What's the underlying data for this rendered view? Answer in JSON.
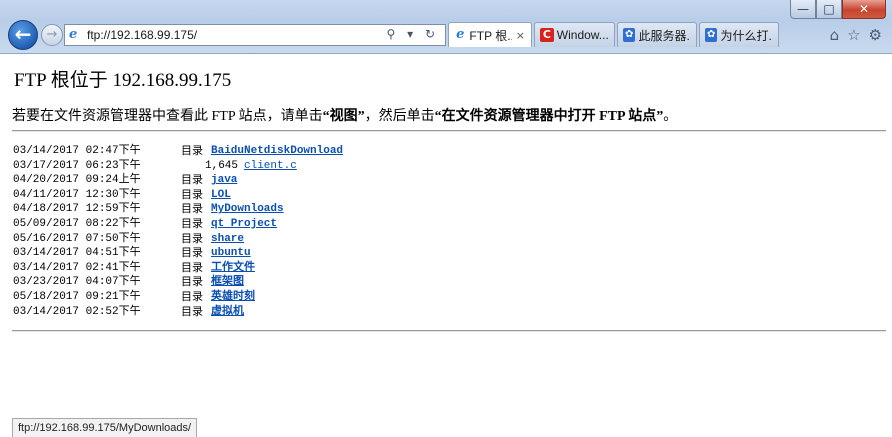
{
  "browser": {
    "address": "ftp://192.168.99.175/",
    "tabs": [
      {
        "label": "FTP 根...",
        "icon": "ie-page-icon",
        "active": true
      },
      {
        "label": "Window...",
        "icon": "red-c-icon",
        "active": false
      },
      {
        "label": "此服务器...",
        "icon": "baidu-paw-icon",
        "active": false
      },
      {
        "label": "为什么打...",
        "icon": "baidu-paw-icon",
        "active": false
      }
    ],
    "tab_close_glyph": "×",
    "addr_tool_glyphs": "⚲ ▾ ↻"
  },
  "page": {
    "heading": "FTP 根位于 192.168.99.175",
    "instruction": {
      "prefix": "若要在文件资源管理器中查看此 FTP 站点，请单击",
      "view": "“视图”",
      "middle": "，然后单击",
      "open": "“在文件资源管理器中打开 FTP 站点”",
      "suffix": "。"
    },
    "entries": [
      {
        "date": "03/14/2017 02:47下午",
        "kind": "目录",
        "size": "",
        "name": "BaiduNetdiskDownload"
      },
      {
        "date": "03/17/2017 06:23下午",
        "kind": "",
        "size": "1,645",
        "name": "client.c"
      },
      {
        "date": "04/20/2017 09:24上午",
        "kind": "目录",
        "size": "",
        "name": "java"
      },
      {
        "date": "04/11/2017 12:30下午",
        "kind": "目录",
        "size": "",
        "name": "LOL"
      },
      {
        "date": "04/18/2017 12:59下午",
        "kind": "目录",
        "size": "",
        "name": "MyDownloads"
      },
      {
        "date": "05/09/2017 08:22下午",
        "kind": "目录",
        "size": "",
        "name": "qt Project"
      },
      {
        "date": "05/16/2017 07:50下午",
        "kind": "目录",
        "size": "",
        "name": "share"
      },
      {
        "date": "03/14/2017 04:51下午",
        "kind": "目录",
        "size": "",
        "name": "ubuntu"
      },
      {
        "date": "03/14/2017 02:41下午",
        "kind": "目录",
        "size": "",
        "name": "工作文件"
      },
      {
        "date": "03/23/2017 04:07下午",
        "kind": "目录",
        "size": "",
        "name": "框架图"
      },
      {
        "date": "05/18/2017 09:21下午",
        "kind": "目录",
        "size": "",
        "name": "英雄时刻"
      },
      {
        "date": "03/14/2017 02:52下午",
        "kind": "目录",
        "size": "",
        "name": "虚拟机"
      }
    ]
  },
  "status_bar": {
    "text": "ftp://192.168.99.175/MyDownloads/"
  },
  "colors": {
    "link": "#0b4fb3",
    "chrome": "#b8cde8",
    "close_button": "#c7442e"
  }
}
